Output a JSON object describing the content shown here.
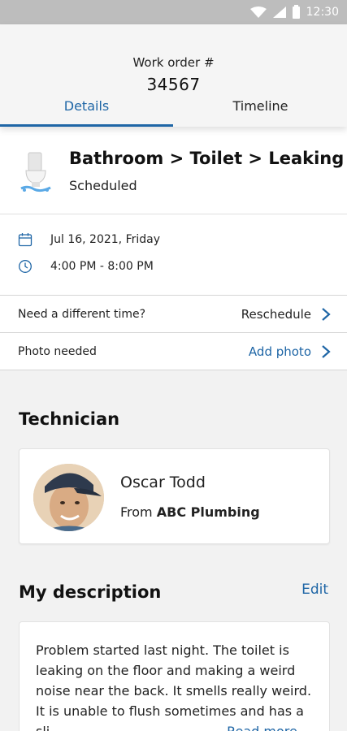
{
  "status_bar": {
    "time": "12:30"
  },
  "header": {
    "work_order_label": "Work order #",
    "work_order_number": "34567",
    "tabs": [
      {
        "label": "Details",
        "active": true
      },
      {
        "label": "Timeline",
        "active": false
      }
    ]
  },
  "summary": {
    "title": "Bathroom > Toilet > Leaking",
    "status": "Scheduled",
    "icon": "toilet-icon"
  },
  "schedule": {
    "date": "Jul 16, 2021, Friday",
    "time": "4:00 PM - 8:00 PM"
  },
  "reschedule_row": {
    "prompt": "Need a different time?",
    "action": "Reschedule"
  },
  "photo_row": {
    "prompt": "Photo needed",
    "action": "Add photo"
  },
  "technician": {
    "section_title": "Technician",
    "name": "Oscar Todd",
    "from_label": "From",
    "company": "ABC Plumbing"
  },
  "description": {
    "section_title": "My description",
    "edit_label": "Edit",
    "text": "Problem started last night. The toilet is leaking on the floor and making a weird noise near the back. It smells really weird. It is unable to flush sometimes and has a sli",
    "read_more_label": "Read more"
  },
  "colors": {
    "accent": "#1f66a6",
    "background": "#f2f2f2",
    "status_bar": "#bdbdbd"
  }
}
